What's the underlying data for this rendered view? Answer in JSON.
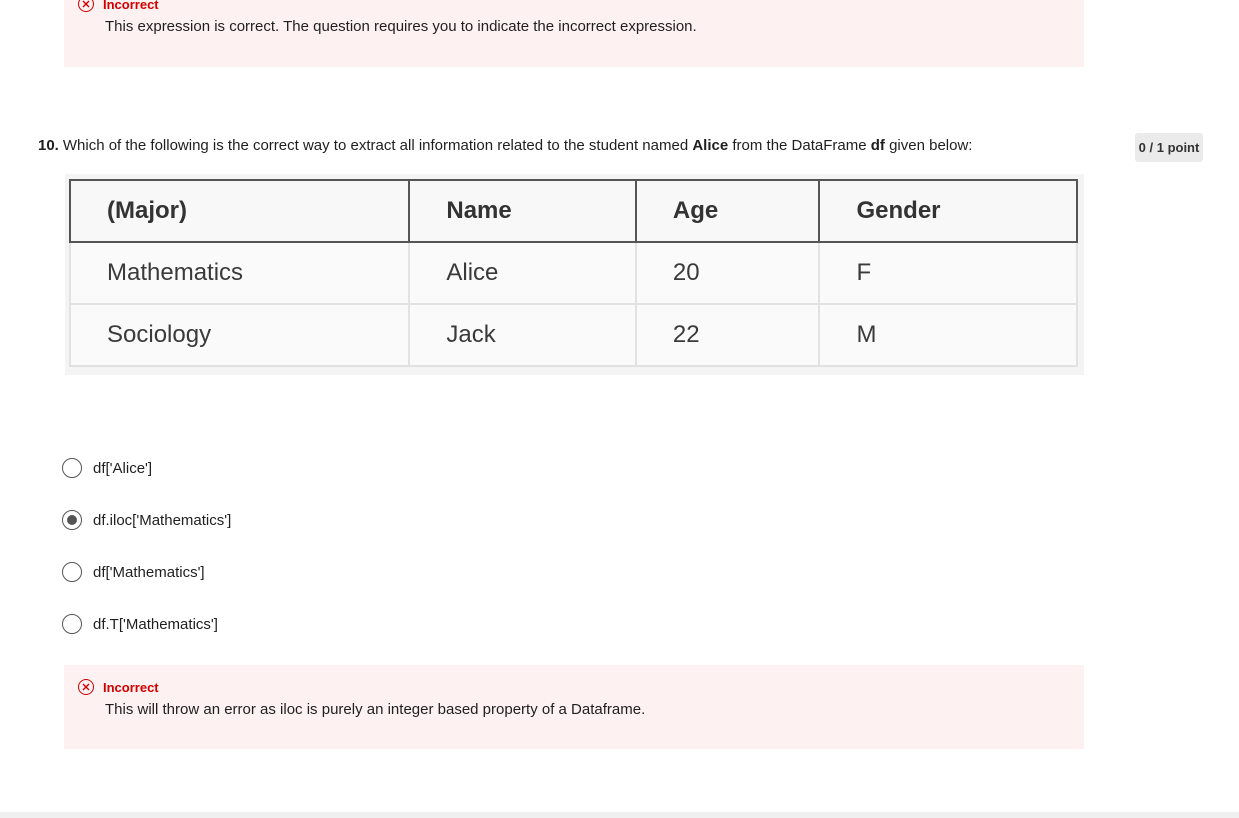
{
  "previous_feedback": {
    "status": "Incorrect",
    "message": "This expression is correct. The question requires you to indicate the incorrect expression."
  },
  "question": {
    "number": "10.",
    "text_before": "Which of the following is the correct way to extract all information related to the student named ",
    "bold_name": "Alice",
    "text_middle": " from the DataFrame ",
    "bold_df": "df",
    "text_after": " given below:",
    "points": "0 / 1 point"
  },
  "table": {
    "headers": [
      "(Major)",
      "Name",
      "Age",
      "Gender"
    ],
    "rows": [
      [
        "Mathematics",
        "Alice",
        "20",
        "F"
      ],
      [
        "Sociology",
        "Jack",
        "22",
        "M"
      ]
    ]
  },
  "options": [
    {
      "label": "df['Alice']",
      "selected": false
    },
    {
      "label": "df.iloc['Mathematics']",
      "selected": true
    },
    {
      "label": "df['Mathematics']",
      "selected": false
    },
    {
      "label": "df.T['Mathematics']",
      "selected": false
    }
  ],
  "feedback": {
    "status": "Incorrect",
    "message": "This will throw an error as iloc is purely an integer based property of a Dataframe."
  },
  "colors": {
    "error": "#d30001",
    "feedback_bg": "#fdf1f1"
  },
  "icons": {
    "status": "x-circle-icon",
    "option": "radio-button-icon"
  }
}
